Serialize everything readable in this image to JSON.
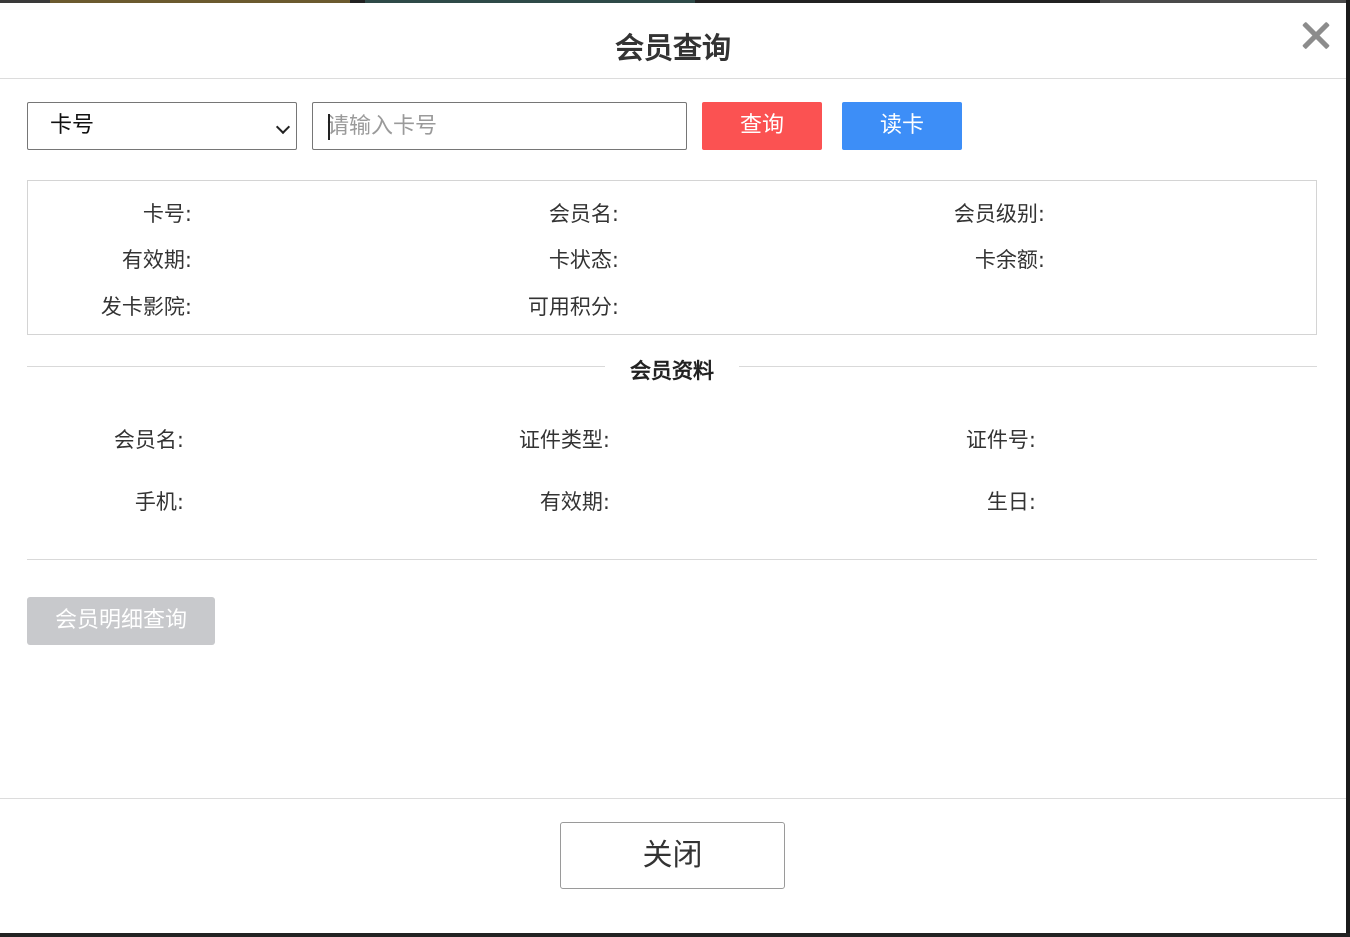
{
  "dialog": {
    "title": "会员查询",
    "close_label": "关闭"
  },
  "search": {
    "type_options": [
      "卡号"
    ],
    "type_selected": "卡号",
    "placeholder": "请输入卡号",
    "value": "",
    "query_label": "查询",
    "read_card_label": "读卡"
  },
  "card_info": {
    "card_no": "卡号:",
    "member_name": "会员名:",
    "member_level": "会员级别:",
    "valid_period": "有效期:",
    "card_status": "卡状态:",
    "card_balance": "卡余额:",
    "issuing_cinema": "发卡影院:",
    "available_points": "可用积分:"
  },
  "member_profile": {
    "section_title": "会员资料",
    "member_name": "会员名:",
    "id_type": "证件类型:",
    "id_no": "证件号:",
    "mobile": "手机:",
    "valid_period": "有效期:",
    "birthday": "生日:"
  },
  "actions": {
    "detail_query_label": "会员明细查询"
  },
  "colors": {
    "query_button": "#fb5252",
    "read_card_button": "#3d8ef7",
    "disabled_button": "#c8c9cc"
  }
}
